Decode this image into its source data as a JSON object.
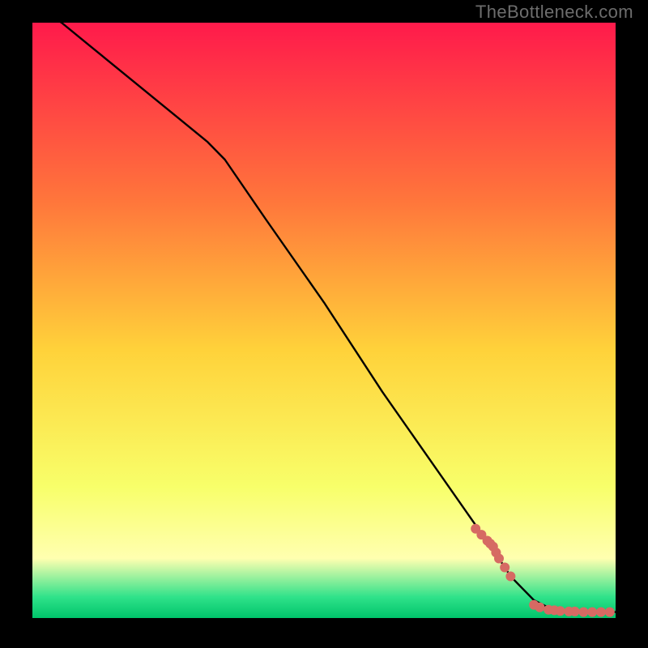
{
  "watermark": "TheBottleneck.com",
  "colors": {
    "background_black": "#000000",
    "line_black": "#000000",
    "points": "#d66a63",
    "watermark": "#6d6d6d",
    "gradient_top": "#ff1a4b",
    "gradient_mid_upper": "#ff763b",
    "gradient_mid": "#ffd23a",
    "gradient_mid_lower": "#f8ff6a",
    "gradient_band": "#ffffb0",
    "gradient_green": "#2fe28a",
    "gradient_bottom": "#00c46a"
  },
  "chart_data": {
    "type": "line",
    "title": "",
    "xlabel": "",
    "ylabel": "",
    "xlim": [
      0,
      100
    ],
    "ylim": [
      0,
      100
    ],
    "grid": false,
    "series": [
      {
        "name": "curve",
        "x": [
          0,
          5,
          10,
          15,
          20,
          25,
          30,
          33,
          40,
          50,
          60,
          70,
          75,
          80,
          82,
          84,
          86,
          88,
          90,
          92,
          94,
          96,
          98,
          100
        ],
        "y": [
          103,
          100,
          96,
          92,
          88,
          84,
          80,
          77,
          67,
          53,
          38,
          24,
          17,
          10,
          7,
          5,
          3,
          2,
          1.5,
          1.2,
          1.0,
          1.0,
          1.0,
          1.0
        ]
      }
    ],
    "points": {
      "name": "markers",
      "x": [
        76,
        77,
        78,
        78.5,
        79,
        79.5,
        80,
        81,
        82,
        86,
        87,
        88.5,
        89.5,
        90.5,
        92,
        93,
        94.5,
        96,
        97.5,
        99
      ],
      "y": [
        15,
        14,
        13,
        12.5,
        12,
        11,
        10,
        8.5,
        7,
        2.2,
        1.8,
        1.4,
        1.3,
        1.2,
        1.1,
        1.1,
        1.0,
        1.0,
        1.0,
        1.0
      ]
    }
  }
}
